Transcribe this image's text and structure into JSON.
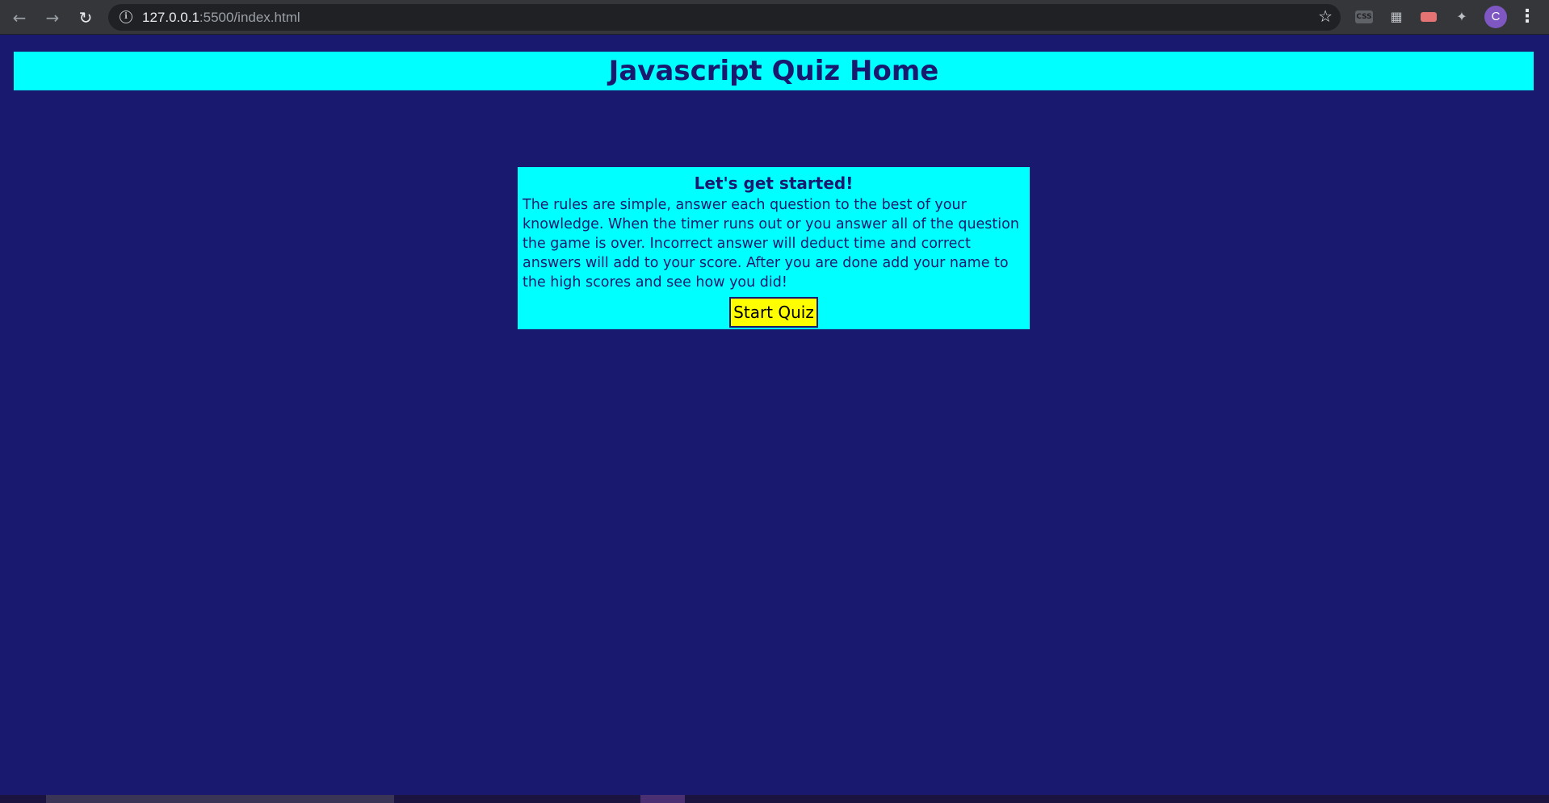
{
  "browser": {
    "url_host": "127.0.0.1",
    "url_rest": ":5500/index.html",
    "profile_initial": "C"
  },
  "header": {
    "title": "Javascript Quiz Home"
  },
  "intro_card": {
    "heading": "Let's get started!",
    "body": "The rules are simple, answer each question to the best of your knowledge. When the timer runs out or you answer all of the question the game is over. Incorrect answer will deduct time and correct answers will add to your score. After you are done add your name to the high scores and see how you did!",
    "start_label": "Start Quiz"
  },
  "colors": {
    "background": "#191970",
    "header_bg": "#00ffff",
    "card_bg": "#00ffff",
    "button_bg": "#ffff00"
  },
  "icons": [
    "back-icon",
    "forward-icon",
    "reload-icon",
    "site-info-icon",
    "bookmark-star-icon",
    "css-extension-icon",
    "palette-extension-icon",
    "record-extension-icon",
    "puzzle-icon",
    "menu-dots-icon"
  ]
}
